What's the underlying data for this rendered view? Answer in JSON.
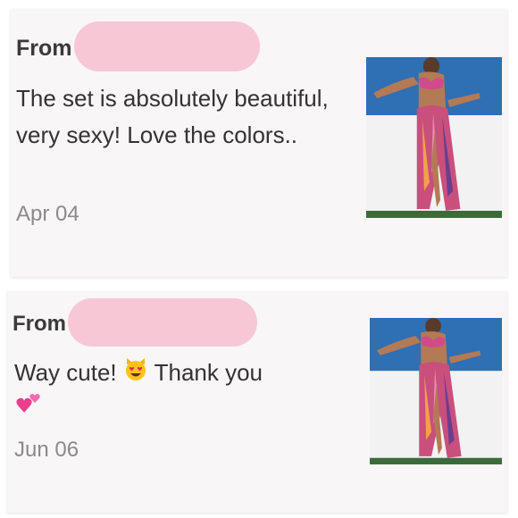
{
  "reviews": [
    {
      "from_label": "From",
      "text": "The set is absolutely beautiful, very sexy! Love the colors..",
      "date": "Apr 04",
      "photo_icon": "product-photo"
    },
    {
      "from_label": "From",
      "text_before_emoji": "Way cute! ",
      "text_after_emoji": " Thank you",
      "emoji_1": "heart-eyes-cat-emoji",
      "emoji_2": "two-hearts-emoji",
      "date": "Jun 06",
      "photo_icon": "product-photo"
    }
  ],
  "colors": {
    "redaction": "#f7c7d6",
    "card_bg": "#f8f6f7",
    "sky": "#2f6fb3",
    "wall": "#f2f2f2"
  }
}
